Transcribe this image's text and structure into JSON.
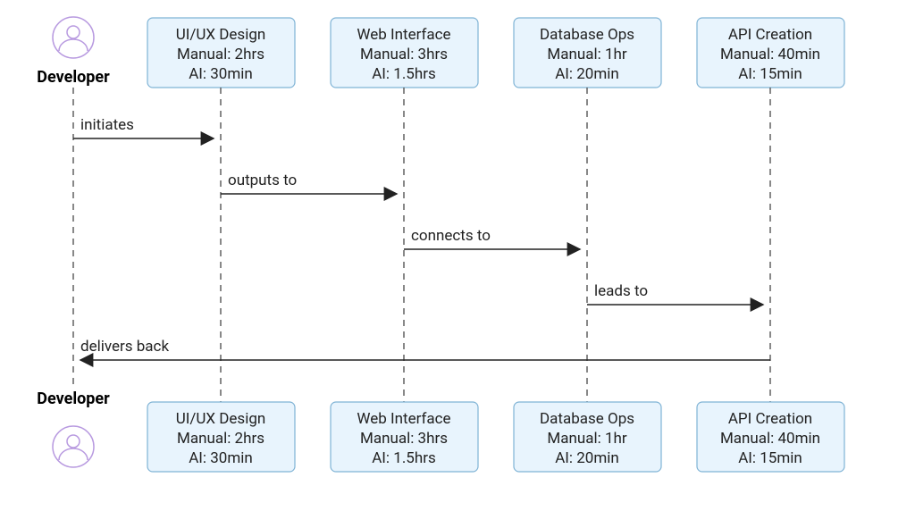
{
  "actor": {
    "label": "Developer"
  },
  "participants": [
    {
      "title": "UI/UX Design",
      "manual": "Manual: 2hrs",
      "ai": "AI: 30min"
    },
    {
      "title": "Web Interface",
      "manual": "Manual: 3hrs",
      "ai": "AI: 1.5hrs"
    },
    {
      "title": "Database Ops",
      "manual": "Manual: 1hr",
      "ai": "AI: 20min"
    },
    {
      "title": "API Creation",
      "manual": "Manual: 40min",
      "ai": "AI: 15min"
    }
  ],
  "messages": [
    {
      "label": "initiates"
    },
    {
      "label": "outputs to"
    },
    {
      "label": "connects to"
    },
    {
      "label": "leads to"
    },
    {
      "label": "delivers back"
    }
  ],
  "chart_data": {
    "type": "table",
    "title": "Sequence diagram: Developer task durations (manual vs AI)",
    "rows": [
      {
        "step": "UI/UX Design",
        "manual_minutes": 120,
        "ai_minutes": 30
      },
      {
        "step": "Web Interface",
        "manual_minutes": 180,
        "ai_minutes": 90
      },
      {
        "step": "Database Ops",
        "manual_minutes": 60,
        "ai_minutes": 20
      },
      {
        "step": "API Creation",
        "manual_minutes": 40,
        "ai_minutes": 15
      }
    ],
    "flow": [
      {
        "from": "Developer",
        "to": "UI/UX Design",
        "label": "initiates"
      },
      {
        "from": "UI/UX Design",
        "to": "Web Interface",
        "label": "outputs to"
      },
      {
        "from": "Web Interface",
        "to": "Database Ops",
        "label": "connects to"
      },
      {
        "from": "Database Ops",
        "to": "API Creation",
        "label": "leads to"
      },
      {
        "from": "API Creation",
        "to": "Developer",
        "label": "delivers back"
      }
    ]
  }
}
